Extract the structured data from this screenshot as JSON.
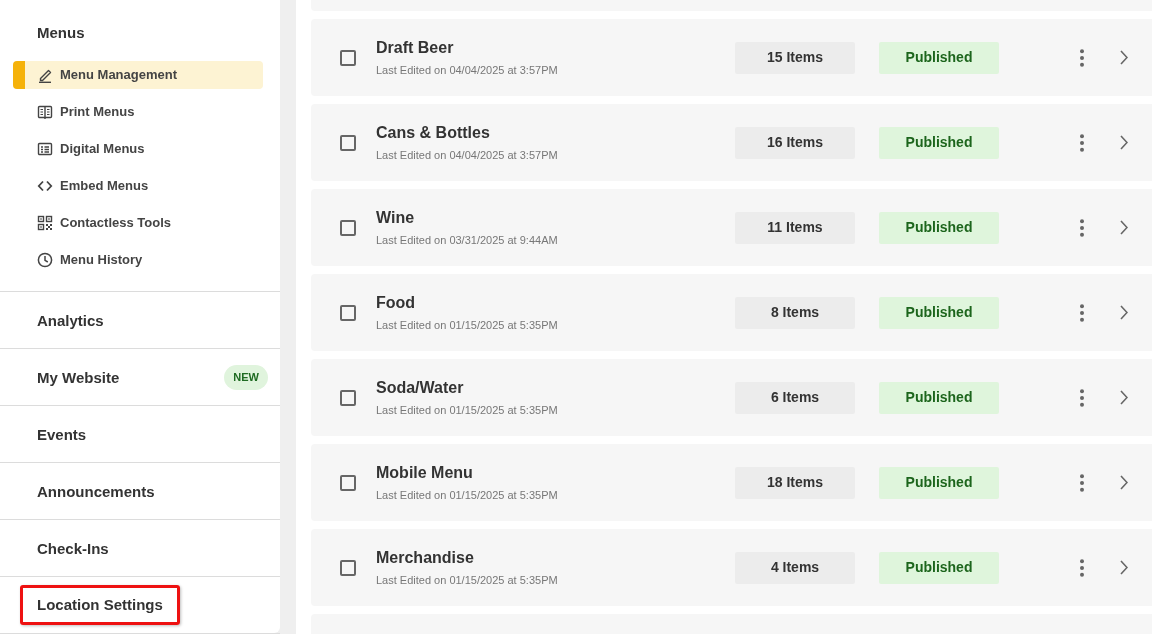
{
  "sidebar": {
    "menus": {
      "title": "Menus",
      "items": [
        {
          "label": "Menu Management",
          "selected": true
        },
        {
          "label": "Print Menus",
          "selected": false
        },
        {
          "label": "Digital Menus",
          "selected": false
        },
        {
          "label": "Embed Menus",
          "selected": false
        },
        {
          "label": "Contactless Tools",
          "selected": false
        },
        {
          "label": "Menu History",
          "selected": false
        }
      ]
    },
    "sections": [
      {
        "label": "Analytics",
        "highlighted": false
      },
      {
        "label": "My Website",
        "badge": "NEW",
        "highlighted": false
      },
      {
        "label": "Events",
        "highlighted": false
      },
      {
        "label": "Announcements",
        "highlighted": false
      },
      {
        "label": "Check-Ins",
        "highlighted": false
      },
      {
        "label": "Location Settings",
        "highlighted": true
      }
    ]
  },
  "menu_cards": [
    {
      "name": "Draft Beer",
      "last_edited": "Last Edited on 04/04/2025 at 3:57PM",
      "item_count": "15 Items",
      "status": "Published",
      "checked": false
    },
    {
      "name": "Cans & Bottles",
      "last_edited": "Last Edited on 04/04/2025 at 3:57PM",
      "item_count": "16 Items",
      "status": "Published",
      "checked": false
    },
    {
      "name": "Wine",
      "last_edited": "Last Edited on 03/31/2025 at 9:44AM",
      "item_count": "11 Items",
      "status": "Published",
      "checked": false
    },
    {
      "name": "Food",
      "last_edited": "Last Edited on 01/15/2025 at 5:35PM",
      "item_count": "8 Items",
      "status": "Published",
      "checked": false
    },
    {
      "name": "Soda/Water",
      "last_edited": "Last Edited on 01/15/2025 at 5:35PM",
      "item_count": "6 Items",
      "status": "Published",
      "checked": false
    },
    {
      "name": "Mobile Menu",
      "last_edited": "Last Edited on 01/15/2025 at 5:35PM",
      "item_count": "18 Items",
      "status": "Published",
      "checked": false
    },
    {
      "name": "Merchandise",
      "last_edited": "Last Edited on 01/15/2025 at 5:35PM",
      "item_count": "4 Items",
      "status": "Published",
      "checked": false
    }
  ]
}
